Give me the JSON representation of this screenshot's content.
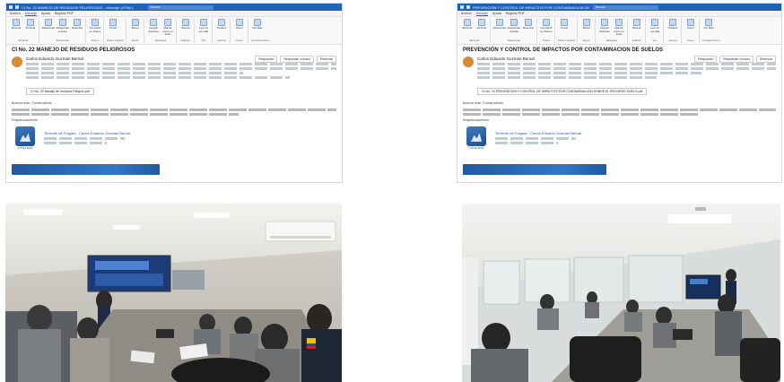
{
  "screens": [
    {
      "window_title": "CI No. 22 MANEJO DE RESIDUOS PELIGROSOS - Mensaje (HTML)",
      "search_placeholder": "Buscar",
      "menus": [
        "Archivo",
        "Mensaje",
        "Ayuda",
        "Registro PDF"
      ],
      "ribbon": [
        {
          "group": "Eliminar",
          "buttons": [
            "Eliminar",
            "Archivar"
          ]
        },
        {
          "group": "Responder",
          "buttons": [
            "Responder",
            "Responder a todos",
            "Reenviar"
          ]
        },
        {
          "group": "Teams",
          "buttons": [
            "Compartir en Teams"
          ]
        },
        {
          "group": "Pasos rápidos",
          "buttons": [
            "Al jefe"
          ]
        },
        {
          "group": "Mover",
          "buttons": [
            "Mover"
          ]
        },
        {
          "group": "Etiquetas",
          "buttons": [
            "Asignar directiva",
            "Marcar como no leído"
          ]
        },
        {
          "group": "Edición",
          "buttons": [
            "Buscar"
          ]
        },
        {
          "group": "Voz",
          "buttons": [
            "Leer en voz alta"
          ]
        },
        {
          "group": "Idioma",
          "buttons": [
            "Traducir"
          ]
        },
        {
          "group": "Zoom",
          "buttons": [
            "Zoom"
          ]
        },
        {
          "group": "Complementos",
          "buttons": [
            "Ver Más"
          ]
        }
      ],
      "subject": "CI No. 22 MANEJO DE RESIDUOS PELIGROSOS",
      "actions": [
        "Responder",
        "Responder a todos",
        "Reenviar"
      ],
      "sender": "Carlos Eduardo Guzmán Bernal",
      "attachment": "CI No. 22 Manejo de residuos Peligros.pdf",
      "greeting": "Buenos días, Cordial saludo",
      "closing": "Respetuosamente",
      "signature_name": "Teniente de Fragata · Carlos Eduardo Guzmán Bernal",
      "logo_label": "COTECMAR"
    },
    {
      "window_title": "PREVENCIÓN Y CONTROL DE IMPACTOS POR CONTAMINACION DE SUELOS - Mensaje (HTML)",
      "search_placeholder": "Buscar",
      "menus": [
        "Archivo",
        "Mensaje",
        "Ayuda",
        "Registro PDF"
      ],
      "ribbon": [
        {
          "group": "Eliminar",
          "buttons": [
            "Eliminar",
            "Archivar"
          ]
        },
        {
          "group": "Responder",
          "buttons": [
            "Responder",
            "Responder a todos",
            "Reenviar"
          ]
        },
        {
          "group": "Teams",
          "buttons": [
            "Compartir en Teams"
          ]
        },
        {
          "group": "Pasos rápidos",
          "buttons": [
            "Al jefe"
          ]
        },
        {
          "group": "Mover",
          "buttons": [
            "Mover"
          ]
        },
        {
          "group": "Etiquetas",
          "buttons": [
            "Asignar directiva",
            "Marcar como no leído"
          ]
        },
        {
          "group": "Edición",
          "buttons": [
            "Buscar"
          ]
        },
        {
          "group": "Voz",
          "buttons": [
            "Leer en voz alta"
          ]
        },
        {
          "group": "Idioma",
          "buttons": [
            "Traducir"
          ]
        },
        {
          "group": "Zoom",
          "buttons": [
            "Zoom"
          ]
        },
        {
          "group": "Complementos",
          "buttons": [
            "Ver Más"
          ]
        }
      ],
      "subject": "PREVENCIÓN Y CONTROL DE IMPACTOS POR CONTAMINACION DE SUELOS",
      "actions": [
        "Responder",
        "Responder a todos",
        "Reenviar"
      ],
      "sender": "Carlos Eduardo Guzmán Bernal",
      "attachment": "CI No. 24 PREVENCION Y CONTROL DE IMPACTOS POR CONTAMINACION SOBRE EL RECURSO SUELO.pdf",
      "greeting": "Buenos días, Cordial saludo",
      "closing": "Respetuosamente",
      "signature_name": "Teniente de Fragata · Carlos Eduardo Guzmán Bernal",
      "logo_label": "COTECMAR"
    }
  ],
  "colors": {
    "outlook_blue": "#1e63b8",
    "avatar": "#d98a34",
    "banner": "#2f78c8"
  }
}
